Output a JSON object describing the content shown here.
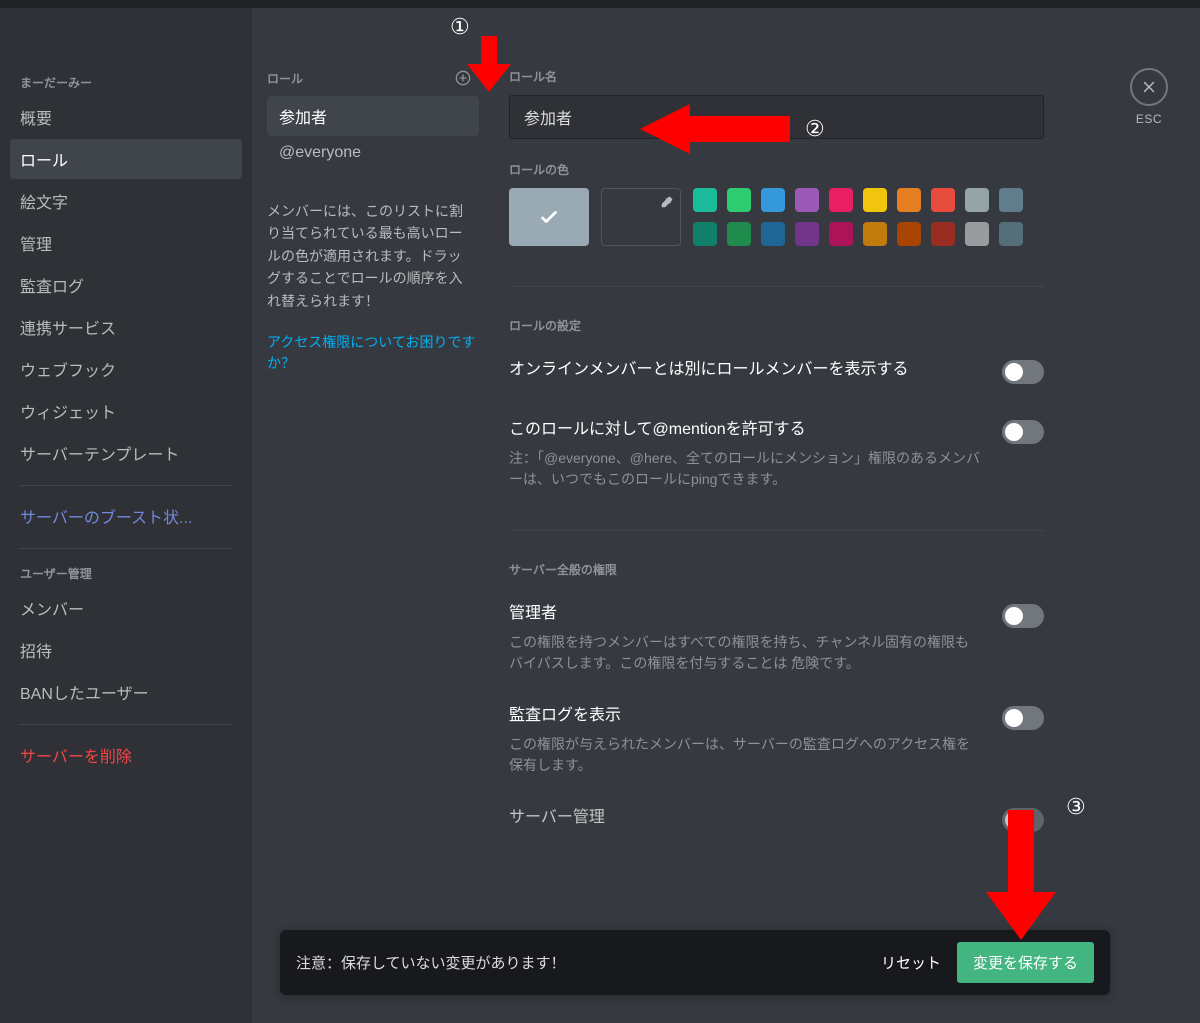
{
  "sidebar": {
    "server_name": "まーだーみー",
    "items": [
      {
        "label": "概要"
      },
      {
        "label": "ロール"
      },
      {
        "label": "絵文字"
      },
      {
        "label": "管理"
      },
      {
        "label": "監査ログ"
      },
      {
        "label": "連携サービス"
      },
      {
        "label": "ウェブフック"
      },
      {
        "label": "ウィジェット"
      },
      {
        "label": "サーバーテンプレート"
      }
    ],
    "boost_item": "サーバーのブースト状...",
    "user_mgmt_header": "ユーザー管理",
    "user_mgmt_items": [
      {
        "label": "メンバー"
      },
      {
        "label": "招待"
      },
      {
        "label": "BANしたユーザー"
      }
    ],
    "delete_server": "サーバーを削除"
  },
  "roles_col": {
    "header": "ロール",
    "list": [
      {
        "label": "参加者"
      },
      {
        "label": "@everyone"
      }
    ],
    "hint": "メンバーには、このリストに割り当てられている最も高いロールの色が適用されます。ドラッグすることでロールの順序を入れ替えられます！",
    "link": "アクセス権限についてお困りですか？"
  },
  "detail": {
    "role_name_label": "ロール名",
    "role_name_value": "参加者",
    "role_color_label": "ロールの色",
    "colors_row1": [
      "#1abc9c",
      "#2ecc71",
      "#3498db",
      "#9b59b6",
      "#e91e63",
      "#f1c40f",
      "#e67e22",
      "#e74c3c",
      "#95a5a6",
      "#607d8b"
    ],
    "colors_row2": [
      "#11806a",
      "#1f8b4c",
      "#206694",
      "#71368a",
      "#ad1457",
      "#c27c0e",
      "#a84300",
      "#992d22",
      "#979c9f",
      "#546e7a"
    ],
    "role_settings_label": "ロールの設定",
    "settings": [
      {
        "title": "オンラインメンバーとは別にロールメンバーを表示する",
        "desc": ""
      },
      {
        "title": "このロールに対して@mentionを許可する",
        "desc": "注：「@everyone、@here、全てのロールにメンション」権限のあるメンバーは、いつでもこのロールにpingできます。"
      }
    ],
    "general_perms_label": "サーバー全般の権限",
    "perms": [
      {
        "title": "管理者",
        "desc": "この権限を持つメンバーはすべての権限を持ち、チャンネル固有の権限もバイパスします。この権限を付与することは 危険です。"
      },
      {
        "title": "監査ログを表示",
        "desc": "この権限が与えられたメンバーは、サーバーの監査ログへのアクセス権を保有します。"
      },
      {
        "title": "サーバー管理",
        "desc": ""
      }
    ]
  },
  "close": {
    "label": "ESC"
  },
  "save_bar": {
    "text": "注意：保存していない変更があります！",
    "reset": "リセット",
    "save": "変更を保存する"
  },
  "annotations": {
    "a1": "①",
    "a2": "②",
    "a3": "③"
  }
}
